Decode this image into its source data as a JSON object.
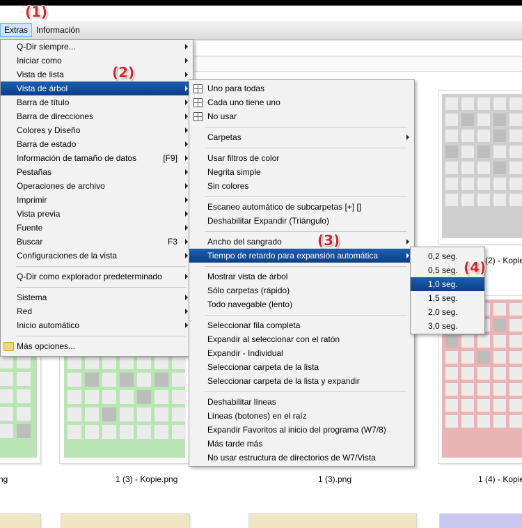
{
  "menubar": {
    "extras": "Extras",
    "info": "Información"
  },
  "badges": [
    "(1)",
    "(2)",
    "(3)",
    "(4)"
  ],
  "menu1": {
    "items": [
      {
        "label": "Q-Dir siempre...",
        "shortcut": "",
        "submenu": true
      },
      {
        "label": "Iniciar como",
        "shortcut": "",
        "submenu": true
      },
      {
        "label": "Vista de lista",
        "shortcut": "",
        "submenu": true
      },
      {
        "label": "Vista de árbol",
        "shortcut": "",
        "submenu": true,
        "highlighted": true
      },
      {
        "label": "Barra de título",
        "shortcut": "",
        "submenu": true
      },
      {
        "label": "Barra de direcciones",
        "shortcut": "",
        "submenu": true
      },
      {
        "label": "Colores y Diseño",
        "shortcut": "",
        "submenu": true
      },
      {
        "label": "Barra de estado",
        "shortcut": "",
        "submenu": true
      },
      {
        "label": "Información de tamaño de datos",
        "shortcut": "[F9]",
        "submenu": true
      },
      {
        "label": "Pestañas",
        "shortcut": "",
        "submenu": true
      },
      {
        "label": "Operaciones de archivo",
        "shortcut": "",
        "submenu": true
      },
      {
        "label": "Imprimir",
        "shortcut": "",
        "submenu": true
      },
      {
        "label": "Vista previa",
        "shortcut": "",
        "submenu": true
      },
      {
        "label": "Fuente",
        "shortcut": "",
        "submenu": true
      },
      {
        "label": "Buscar",
        "shortcut": "F3",
        "submenu": true
      },
      {
        "label": "Configuraciones de la vista",
        "shortcut": "",
        "submenu": true
      },
      {
        "label": "Q-Dir como explorador predeterminado",
        "shortcut": "",
        "submenu": true
      },
      {
        "label": "Sistema",
        "shortcut": "",
        "submenu": true
      },
      {
        "label": "Red",
        "shortcut": "",
        "submenu": true
      },
      {
        "label": "Inicio automático",
        "shortcut": "",
        "submenu": true
      },
      {
        "label": "Más opciones...",
        "shortcut": "",
        "submenu": false,
        "icon": "folder-icon"
      }
    ]
  },
  "menu2": {
    "items": [
      {
        "label": "Uno para todas",
        "icon": "grid-icon"
      },
      {
        "label": "Cada uno tiene uno",
        "icon": "grid-icon"
      },
      {
        "label": "No usar",
        "icon": "grid-icon"
      },
      {
        "label": "Carpetas",
        "submenu": true
      },
      {
        "label": "Usar filtros de color"
      },
      {
        "label": "Negrita simple"
      },
      {
        "label": "Sin colores"
      },
      {
        "label": "Escaneo automático de subcarpetas [+] []"
      },
      {
        "label": "Deshabilitar Expandir (Triángulo)"
      },
      {
        "label": "Ancho del sangrado",
        "submenu": true
      },
      {
        "label": "Tiempo de retardo para expansión automática",
        "submenu": true,
        "highlighted": true
      },
      {
        "label": "Mostrar vista de árbol"
      },
      {
        "label": "Sólo carpetas (rápido)"
      },
      {
        "label": "Todo navegable (lento)"
      },
      {
        "label": "Seleccionar fila completa"
      },
      {
        "label": "Expandir al seleccionar con el ratón"
      },
      {
        "label": "Expandir - Individual"
      },
      {
        "label": "Seleccionar carpeta de la lista"
      },
      {
        "label": "Seleccionar carpeta de la lista y expandir"
      },
      {
        "label": "Deshabilitar líneas"
      },
      {
        "label": "Líneas (botones) en el raíz"
      },
      {
        "label": "Expandir Favoritos al inicio del programa (W7/8)"
      },
      {
        "label": "Más tarde más"
      },
      {
        "label": "No usar estructura de directorios de W7/Vista"
      }
    ]
  },
  "menu3": {
    "items": [
      {
        "label": "0,2 seg."
      },
      {
        "label": "0,5 seg."
      },
      {
        "label": "1,0 seg.",
        "highlighted": true
      },
      {
        "label": "1,5 seg."
      },
      {
        "label": "2,0 seg."
      },
      {
        "label": "3,0 seg."
      }
    ]
  },
  "thumbnails": {
    "labels": [
      "ng",
      "1 (3) - Kopie.png",
      "1 (3).png",
      "1 (4) - Kopie",
      "(2) - Kopie"
    ]
  },
  "colors": {
    "highlight": "#1c5fb0",
    "badge": "#d8232a",
    "green": "#b9e5b4",
    "gray": "#cfcfcf",
    "pink": "#e8b4b4",
    "yellow": "#efe7c2",
    "lavender": "#c9c9ef"
  }
}
